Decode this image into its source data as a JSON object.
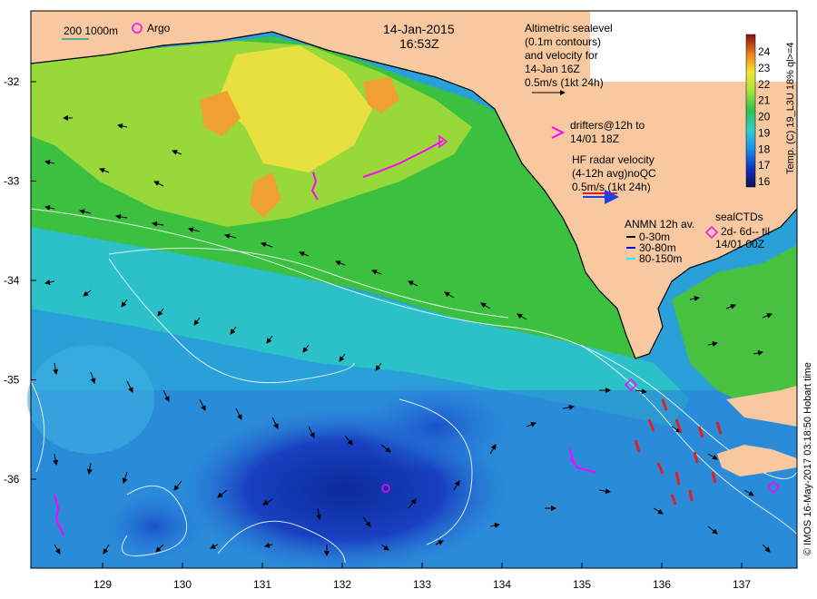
{
  "header": {
    "date": "14-Jan-2015",
    "time": "16:53Z",
    "scale_bar_label": "200  1000m",
    "argo_label": "Argo"
  },
  "altimetry": {
    "line1": "Altimetric sealevel",
    "line2": "(0.1m contours)",
    "line3": "and velocity for",
    "line4": "14-Jan 16Z",
    "line5": "0.5m/s (1kt 24h)"
  },
  "drifters": {
    "line1": "drifters@12h to",
    "line2": "14/01 18Z"
  },
  "hf_radar": {
    "line1": "HF radar velocity",
    "line2": "(4-12h avg)noQC",
    "line3": "0.5m/s (1kt 24h)"
  },
  "anmn": {
    "title": "ANMN 12h av.",
    "items": [
      {
        "label": "0-30m",
        "color": "#000000"
      },
      {
        "label": "30-80m",
        "color": "#0000ff"
      },
      {
        "label": "80-150m",
        "color": "#00ffff"
      }
    ]
  },
  "seal": {
    "title": "sealCTDs",
    "line1": "2d- 6d-- til",
    "line2": "14/01 00Z"
  },
  "colorbar": {
    "ticks": [
      "16",
      "17",
      "18",
      "19",
      "20",
      "21",
      "22",
      "23",
      "24"
    ],
    "label": "Temp. (C) 19_L3U 18% ql>=4"
  },
  "axes": {
    "lat_ticks": [
      "-32",
      "-33",
      "-34",
      "-35",
      "-36"
    ],
    "lon_ticks": [
      "129",
      "130",
      "131",
      "132",
      "133",
      "134",
      "135",
      "136",
      "137"
    ]
  },
  "copyright": "© IMOS 16-May-2017 03:18:50 Hobart time",
  "colors": {
    "land": "#f8c8a0",
    "warm": "#f4e040",
    "mid": "#40c040",
    "cool": "#20a0e0",
    "cold": "#1030b0",
    "drifter": "#ff00ff",
    "hf_radar": "#e02020"
  }
}
